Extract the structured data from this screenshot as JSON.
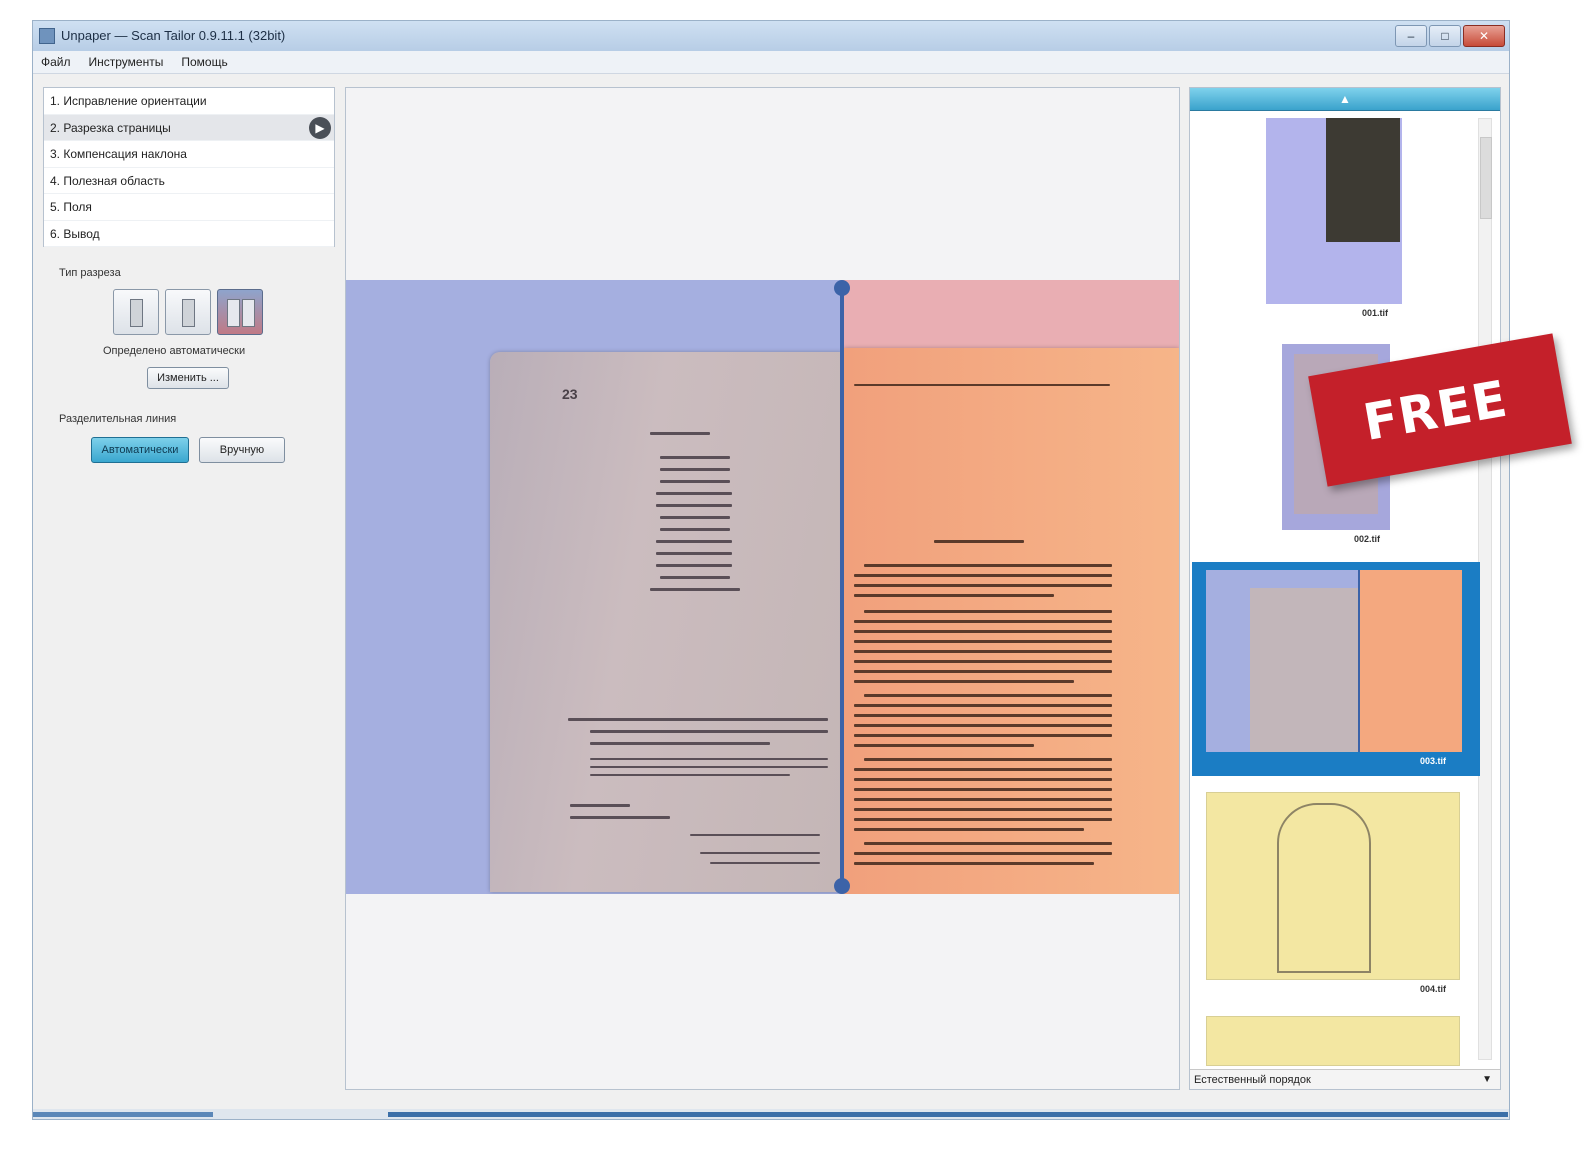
{
  "window": {
    "title": "Unpaper — Scan Tailor 0.9.11.1 (32bit)",
    "minimize": "–",
    "maximize": "□",
    "close": "✕"
  },
  "menu": {
    "items": [
      "Файл",
      "Инструменты",
      "Помощь"
    ]
  },
  "stages": {
    "items": [
      "1. Исправление ориентации",
      "2. Разрезка страницы",
      "3. Компенсация наклона",
      "4. Полезная область",
      "5. Поля",
      "6. Вывод"
    ],
    "selected_index": 1,
    "run_glyph": "▶"
  },
  "options": {
    "layout_type_label": "Тип разреза",
    "auto_detected_label": "Определено автоматически",
    "change_button": "Изменить ...",
    "split_line_label": "Разделительная линия",
    "auto_button": "Автоматически",
    "manual_button": "Вручную"
  },
  "viewer": {
    "page_number": "23"
  },
  "thumbnails": {
    "scroll_up": "▲",
    "labels": [
      "001.tif",
      "002.tif",
      "003.tif",
      "004.tif"
    ],
    "selected_index": 2,
    "filter_label": "Естественный порядок",
    "filter_arrow": "▼"
  },
  "badge": {
    "text": "FREE"
  },
  "colors": {
    "left_region": "#a5afe0",
    "right_region": "#f6b589",
    "divider": "#3c63a8",
    "badge": "#c4202a",
    "accent": "#3aa7cf"
  }
}
